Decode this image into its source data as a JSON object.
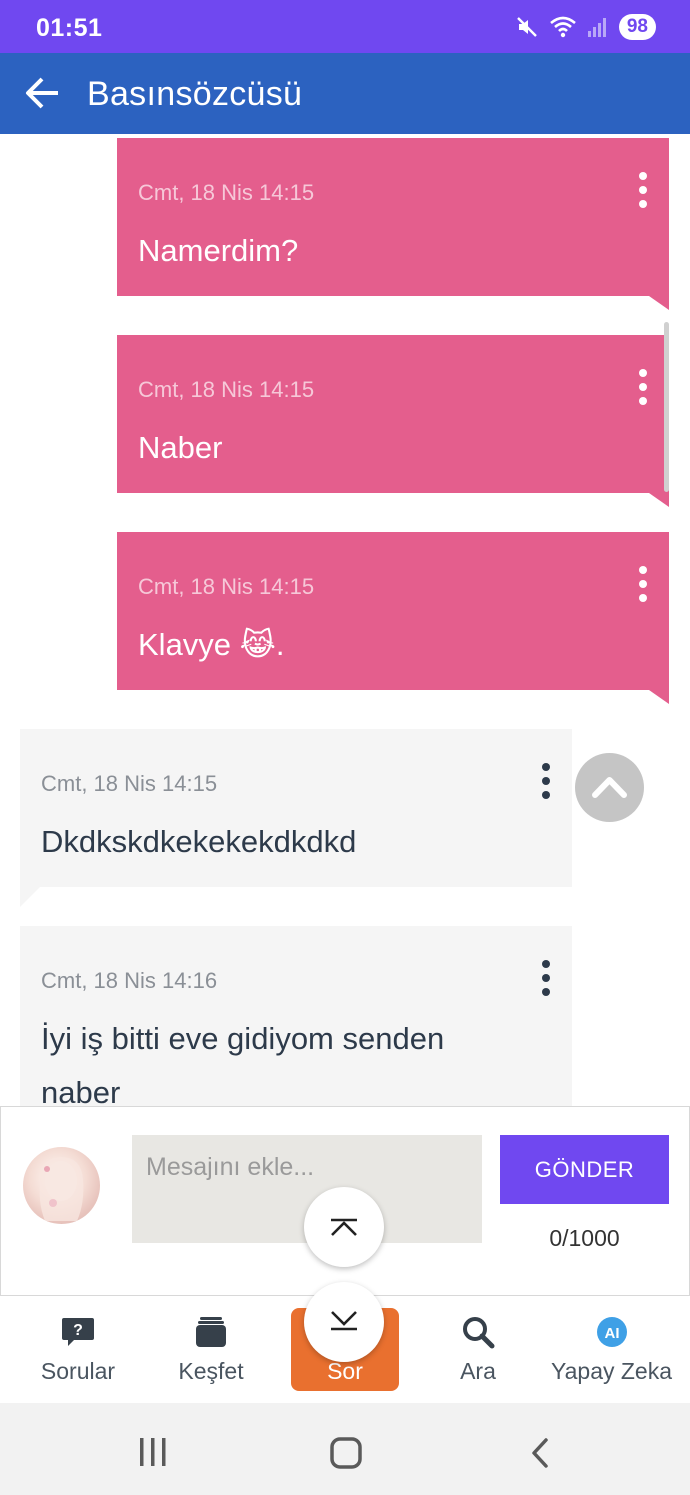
{
  "status_bar": {
    "time": "01:51",
    "battery": "98"
  },
  "header": {
    "title": "Basınsözcüsü"
  },
  "messages": [
    {
      "sender": "me",
      "time": "Cmt, 18 Nis 14:15",
      "text": "Namerdim?"
    },
    {
      "sender": "me",
      "time": "Cmt, 18 Nis 14:15",
      "text": "Naber"
    },
    {
      "sender": "me",
      "time": "Cmt, 18 Nis 14:15",
      "text": "Klavye 😹."
    },
    {
      "sender": "other",
      "time": "Cmt, 18 Nis 14:15",
      "text": "Dkdkskdkekekekdkdkd"
    },
    {
      "sender": "other",
      "time": "Cmt, 18 Nis 14:16",
      "text": "İyi iş bitti eve gidiyom senden naber"
    }
  ],
  "composer": {
    "placeholder": "Mesajını ekle...",
    "send_label": "GÖNDER",
    "char_count": "0/1000"
  },
  "bottom_nav": [
    {
      "label": "Sorular",
      "icon": "question-bubble-icon"
    },
    {
      "label": "Keşfet",
      "icon": "stack-icon"
    },
    {
      "label": "Sor",
      "icon": "ask-icon"
    },
    {
      "label": "Ara",
      "icon": "search-icon"
    },
    {
      "label": "Yapay Zeka",
      "icon": "ai-icon"
    }
  ],
  "colors": {
    "status_bar": "#7048f0",
    "app_bar": "#2c62c0",
    "my_bubble": "#e45e8d",
    "other_bubble": "#f5f5f5",
    "send_button": "#7048f0",
    "sor_tab": "#e9702f"
  }
}
